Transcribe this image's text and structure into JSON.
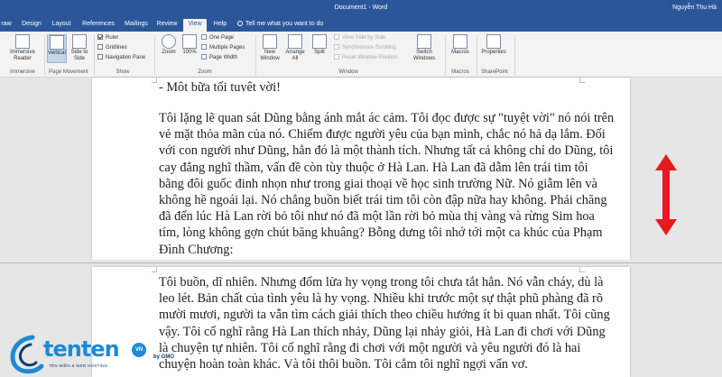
{
  "window": {
    "doc_title": "Document1 - Word",
    "user_name": "Nguyễn Thu Hà"
  },
  "tabs": [
    {
      "label": "raw"
    },
    {
      "label": "Design"
    },
    {
      "label": "Layout"
    },
    {
      "label": "References"
    },
    {
      "label": "Mailings"
    },
    {
      "label": "Review"
    },
    {
      "label": "View"
    },
    {
      "label": "Help"
    }
  ],
  "active_tab": "View",
  "tell_me": "Tell me what you want to do",
  "ribbon": {
    "immersive": {
      "button": "Immersive Reader",
      "group": "Immersive"
    },
    "page_movement": {
      "vertical": "Vertical",
      "side_to_side": "Side to Side",
      "group": "Page Movement"
    },
    "show": {
      "ruler": "Ruler",
      "ruler_checked": true,
      "gridlines": "Gridlines",
      "gridlines_checked": false,
      "nav_pane": "Navigation Pane",
      "nav_pane_checked": false,
      "group": "Show"
    },
    "zoom": {
      "zoom": "Zoom",
      "percent": "100%",
      "one_page": "One Page",
      "multiple_pages": "Multiple Pages",
      "page_width": "Page Width",
      "group": "Zoom"
    },
    "window": {
      "new_window": "New Window",
      "arrange_all": "Arrange All",
      "split": "Split",
      "view_side_by_side": "View Side by Side",
      "sync_scrolling": "Synchronous Scrolling",
      "reset_window": "Reset Window Position",
      "switch_windows": "Switch Windows",
      "group": "Window"
    },
    "macros": {
      "button": "Macros",
      "group": "Macros"
    },
    "sharepoint": {
      "button": "Properties",
      "group": "SharePoint"
    }
  },
  "document": {
    "page1_partial_line": "- Một bữa tối tuyệt vời!",
    "page1_paragraph": "Tôi lặng lẽ quan sát Dũng bằng ánh mắt ác cảm. Tôi đọc được sự \"tuyệt vời\" nó nói trên vẻ mặt thỏa mãn của nó. Chiếm được người yêu của bạn mình, chắc nó hả dạ lắm. Đối với con người như Dũng, hẳn đó là một thành tích. Nhưng tất cả không chỉ do Dũng, tôi cay đắng nghĩ thầm, vấn đề còn tùy thuộc ở Hà Lan. Hà Lan đã dẫm lên trái tim tôi bằng đôi guốc đinh nhọn như trong giai thoại về học sinh trường Nữ. Nó giẫm lên và không hề ngoái lại. Nó chẳng buồn biết trái tim tôi còn đập nữa hay không. Phải chăng đã đến lúc Hà Lan rời bỏ tôi như nó đã một lần rời bỏ mùa thị vàng và rừng Sim hoa tím, lòng không gợn chút băng khuâng? Bỗng dưng tôi nhớ tới một ca khúc của Phạm Đình Chương:",
    "page2_paragraph": "Tôi buồn, dĩ nhiên. Nhưng đốm lửa hy vọng trong tôi chưa tắt hẳn. Nó vẫn cháy, dù là leo lét. Bản chất của tình yêu là hy vọng. Nhiều khi trước một sự thật phũ phàng đã rõ mười mươi, người ta vẫn tìm cách giải thích theo chiều hướng ít bi quan nhất. Tôi cũng vậy. Tôi cố nghĩ rằng Hà Lan thích nhảy, Dũng lại nhảy giỏi, Hà Lan đi chơi với Dũng là chuyện tự nhiên. Tôi cố nghĩ rằng đi chơi với một người và yêu người đó là hai chuyện hoàn toàn khác. Và tôi thôi buồn. Tôi cắm tôi nghĩ ngợi vẩn vơ."
  },
  "watermark": {
    "brand": "tenten",
    "badge": "VN",
    "tagline": "TÊN MIỀN & WEB HOSTING",
    "by": "by GMO"
  },
  "colors": {
    "word_blue": "#2b579a",
    "arrow_red": "#e8191f",
    "logo_blue": "#1c8ad6"
  },
  "icons": [
    "immersive-reader-icon",
    "vertical-icon",
    "side-to-side-icon",
    "zoom-icon",
    "new-window-icon",
    "arrange-all-icon",
    "split-icon",
    "switch-windows-icon",
    "macros-icon",
    "properties-icon",
    "lightbulb-icon"
  ]
}
